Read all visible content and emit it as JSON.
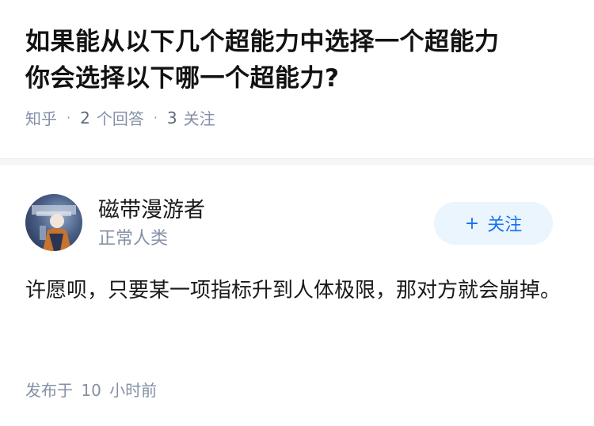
{
  "question": {
    "title_line1": "如果能从以下几个超能力中选择一个超能力",
    "title_line2": "你会选择以下哪一个超能力?",
    "source": "知乎",
    "answer_count": "2",
    "answer_label": "个回答",
    "follow_count": "3",
    "follow_label": "关注"
  },
  "answer": {
    "author_name": "磁带漫游者",
    "author_bio": "正常人类",
    "follow_button": "关注",
    "follow_icon": "plus-icon",
    "content": "许愿呗，只要某一项指标升到人体极限，那对方就会崩掉。",
    "time_prefix": "发布于",
    "time_value": "10",
    "time_suffix": "小时前"
  }
}
